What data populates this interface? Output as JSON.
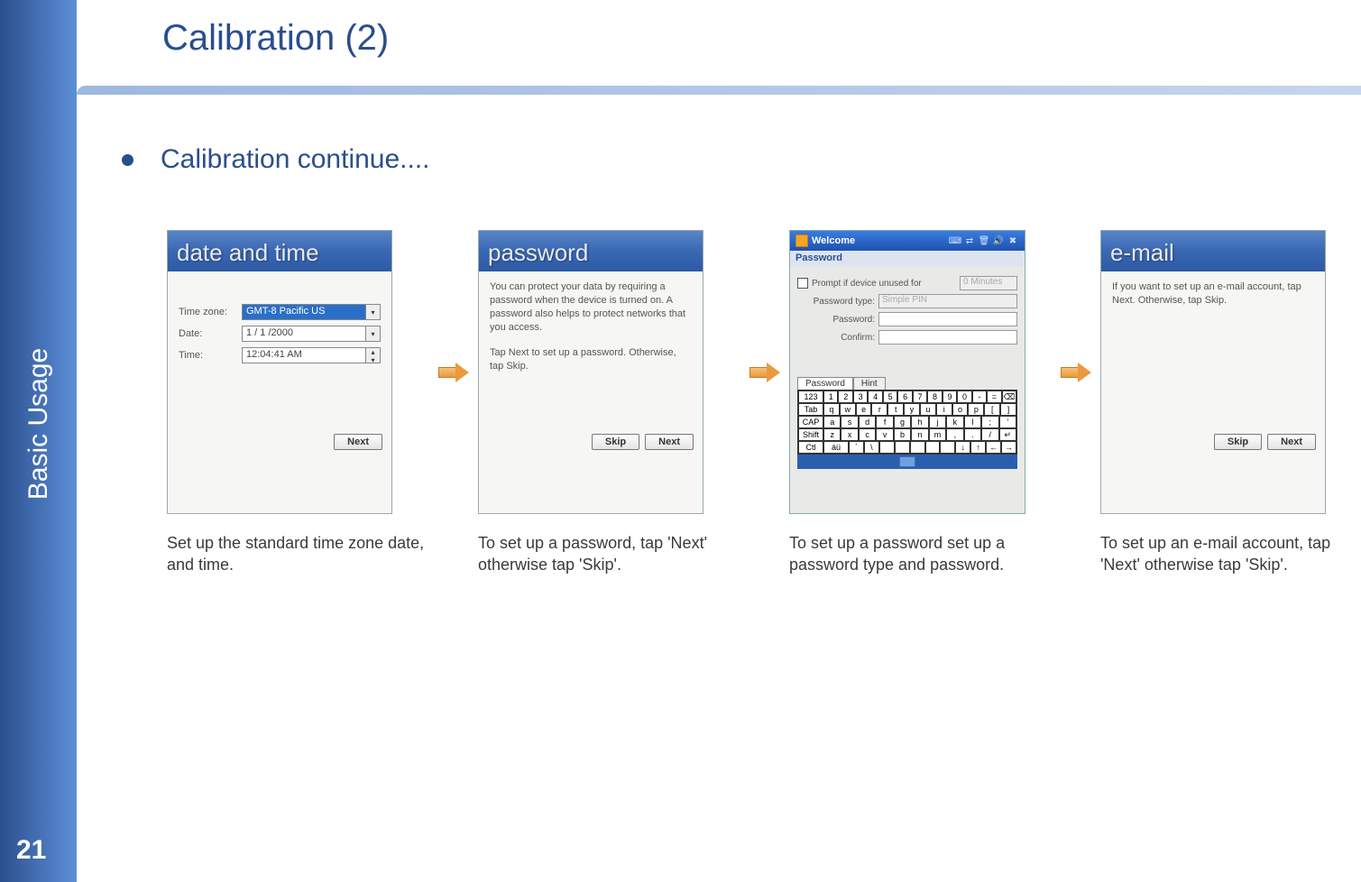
{
  "sidebar": {
    "label": "Basic Usage",
    "page_number": "21"
  },
  "title": "Calibration (2)",
  "bullet": "Calibration continue....",
  "panel1": {
    "header": "date and time",
    "tz_label": "Time zone:",
    "tz_value": "GMT-8 Pacific US",
    "date_label": "Date:",
    "date_value": "1 / 1 /2000",
    "time_label": "Time:",
    "time_value": "12:04:41 AM",
    "next": "Next",
    "caption": "Set up the standard time zone date, and time."
  },
  "panel2": {
    "header": "password",
    "body1": "You can protect your data by requiring a password when the device is turned on. A password also helps to protect networks that you access.",
    "body2": "Tap Next to set up a password. Otherwise, tap Skip.",
    "skip": "Skip",
    "next": "Next",
    "caption": "To set up a password, tap 'Next' otherwise tap  'Skip'."
  },
  "panel3": {
    "title": "Welcome",
    "tray_icons": [
      "⌨",
      "⇄",
      "🗑",
      "🔊",
      "✖"
    ],
    "sub": "Password",
    "prompt_label": "Prompt if device unused for",
    "prompt_value": "0 Minutes",
    "type_label": "Password type:",
    "type_value": "Simple PIN",
    "pw_label": "Password:",
    "cf_label": "Confirm:",
    "tab1": "Password",
    "tab2": "Hint",
    "kbd_rows": [
      [
        "123",
        "1",
        "2",
        "3",
        "4",
        "5",
        "6",
        "7",
        "8",
        "9",
        "0",
        "-",
        "=",
        "⌫"
      ],
      [
        "Tab",
        "q",
        "w",
        "e",
        "r",
        "t",
        "y",
        "u",
        "i",
        "o",
        "p",
        "[",
        "]"
      ],
      [
        "CAP",
        "a",
        "s",
        "d",
        "f",
        "g",
        "h",
        "j",
        "k",
        "l",
        ";",
        "'"
      ],
      [
        "Shift",
        "z",
        "x",
        "c",
        "v",
        "b",
        "n",
        "m",
        ",",
        ".",
        "/",
        "↵"
      ],
      [
        "Ctl",
        "áü",
        "`",
        "\\",
        "",
        "",
        "",
        "",
        "",
        "↓",
        "↑",
        "←",
        "→"
      ]
    ],
    "caption": "To set up a password set up a password type and password."
  },
  "panel4": {
    "header": "e-mail",
    "body": "If you want to set up an e-mail account, tap Next. Otherwise, tap Skip.",
    "skip": "Skip",
    "next": "Next",
    "caption": "To set up an e-mail account, tap  'Next' otherwise tap 'Skip'."
  }
}
